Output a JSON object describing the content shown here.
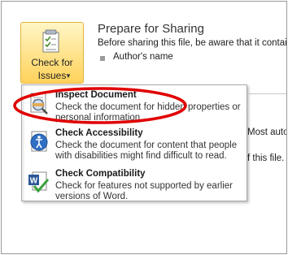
{
  "prepare": {
    "title": "Prepare for Sharing",
    "description": "Before sharing this file, be aware that it contains",
    "bullet": "Author's name"
  },
  "check_issues_button": {
    "line1": "Check for",
    "line2": "Issues"
  },
  "background_text": {
    "line1": "Most auto",
    "line2": "f this file."
  },
  "menu": {
    "items": [
      {
        "icon": "inspect-document-icon",
        "title": "Inspect Document",
        "description": "Check the document for hidden properties or personal information."
      },
      {
        "icon": "accessibility-icon",
        "title": "Check Accessibility",
        "description": "Check the document for content that people with disabilities might find difficult to read."
      },
      {
        "icon": "word-compatibility-icon",
        "title": "Check Compatibility",
        "description": "Check for features not supported by earlier versions of Word."
      }
    ]
  },
  "colors": {
    "button_highlight": "#ffd25a",
    "annotation_ellipse": "#e00000"
  }
}
